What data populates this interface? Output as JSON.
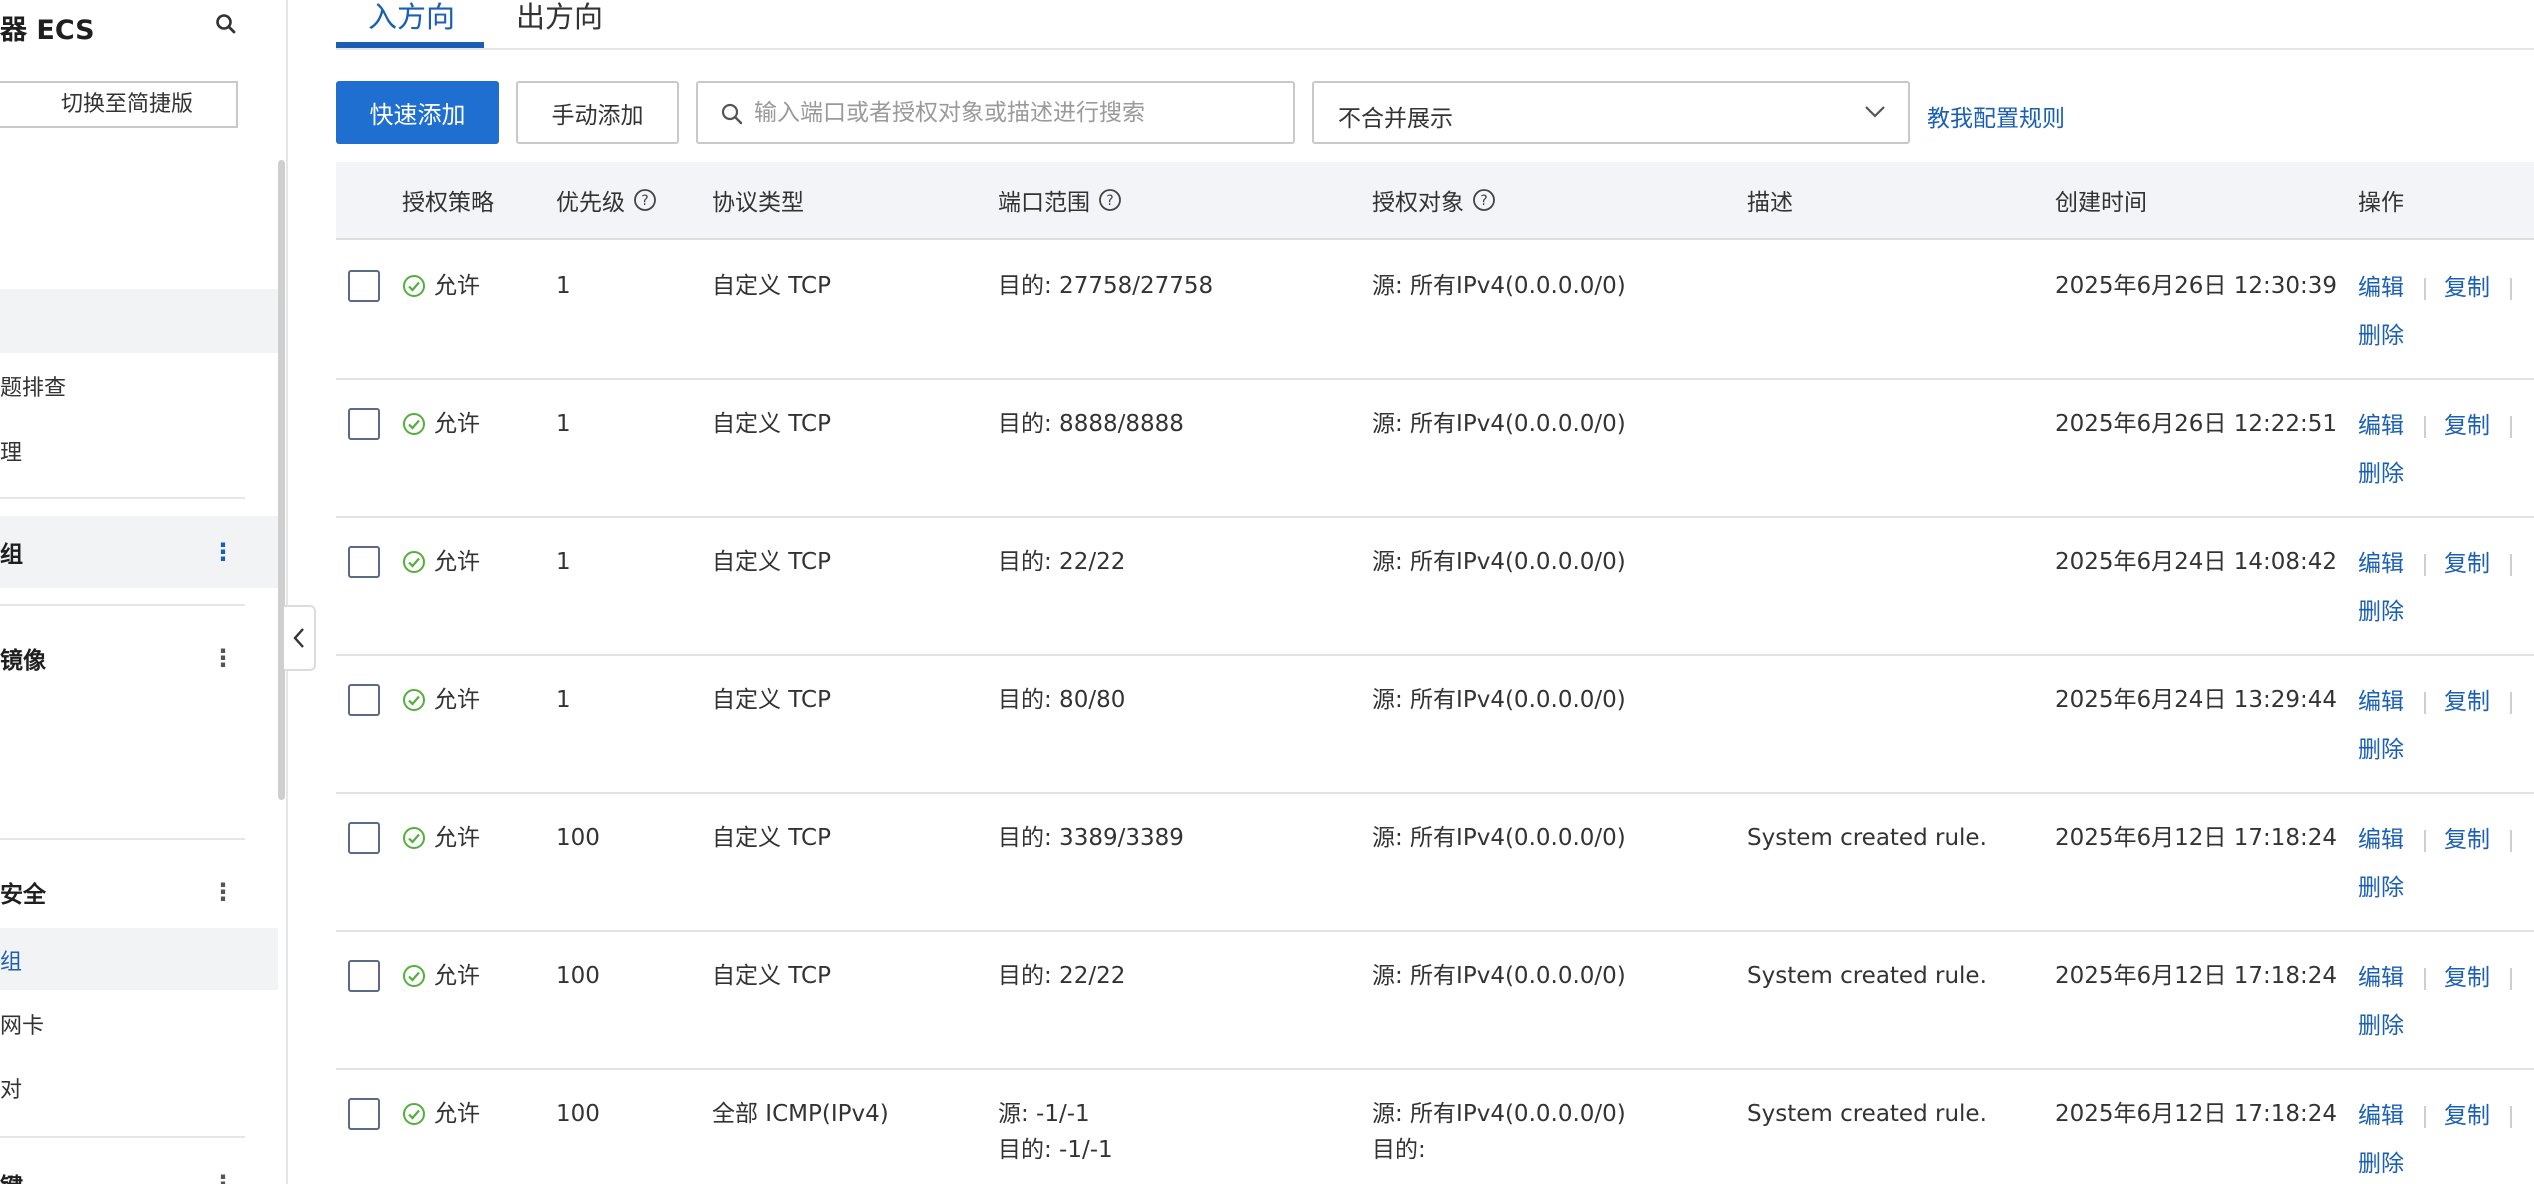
{
  "sidebar": {
    "title": "器 ECS",
    "switch_label": "切换至简捷版",
    "items": [
      {
        "label": "题排查"
      },
      {
        "label": "理"
      },
      {
        "label": "组"
      },
      {
        "label": "镜像"
      },
      {
        "label": "安全"
      },
      {
        "label": "组"
      },
      {
        "label": "网卡"
      },
      {
        "label": "对"
      },
      {
        "label": "键"
      }
    ]
  },
  "tabs": [
    {
      "label": "入方向",
      "active": true
    },
    {
      "label": "出方向",
      "active": false
    }
  ],
  "toolbar": {
    "quick_add": "快速添加",
    "manual_add": "手动添加",
    "search_placeholder": "输入端口或者授权对象或描述进行搜索",
    "merge_select": "不合并展示",
    "help_link": "教我配置规则"
  },
  "table": {
    "headers": {
      "policy": "授权策略",
      "priority": "优先级",
      "protocol": "协议类型",
      "port": "端口范围",
      "target": "授权对象",
      "desc": "描述",
      "created": "创建时间",
      "ops": "操作"
    },
    "actions": {
      "edit": "编辑",
      "copy": "复制",
      "delete": "删除"
    },
    "rows": [
      {
        "policy": "允许",
        "priority": "1",
        "protocol": "自定义 TCP",
        "port": "目的: 27758/27758",
        "port2": "",
        "target": "源: 所有IPv4(0.0.0.0/0)",
        "target2": "",
        "desc": "",
        "created": "2025年6月26日 12:30:39"
      },
      {
        "policy": "允许",
        "priority": "1",
        "protocol": "自定义 TCP",
        "port": "目的: 8888/8888",
        "port2": "",
        "target": "源: 所有IPv4(0.0.0.0/0)",
        "target2": "",
        "desc": "",
        "created": "2025年6月26日 12:22:51"
      },
      {
        "policy": "允许",
        "priority": "1",
        "protocol": "自定义 TCP",
        "port": "目的: 22/22",
        "port2": "",
        "target": "源: 所有IPv4(0.0.0.0/0)",
        "target2": "",
        "desc": "",
        "created": "2025年6月24日 14:08:42"
      },
      {
        "policy": "允许",
        "priority": "1",
        "protocol": "自定义 TCP",
        "port": "目的: 80/80",
        "port2": "",
        "target": "源: 所有IPv4(0.0.0.0/0)",
        "target2": "",
        "desc": "",
        "created": "2025年6月24日 13:29:44"
      },
      {
        "policy": "允许",
        "priority": "100",
        "protocol": "自定义 TCP",
        "port": "目的: 3389/3389",
        "port2": "",
        "target": "源: 所有IPv4(0.0.0.0/0)",
        "target2": "",
        "desc": "System created rule.",
        "created": "2025年6月12日 17:18:24"
      },
      {
        "policy": "允许",
        "priority": "100",
        "protocol": "自定义 TCP",
        "port": "目的: 22/22",
        "port2": "",
        "target": "源: 所有IPv4(0.0.0.0/0)",
        "target2": "",
        "desc": "System created rule.",
        "created": "2025年6月12日 17:18:24"
      },
      {
        "policy": "允许",
        "priority": "100",
        "protocol": "全部 ICMP(IPv4)",
        "port": "源: -1/-1",
        "port2": "目的: -1/-1",
        "target": "源: 所有IPv4(0.0.0.0/0)",
        "target2": "目的:",
        "desc": "System created rule.",
        "created": "2025年6月12日 17:18:24"
      }
    ]
  },
  "colors": {
    "accent": "#1f6fd1",
    "link": "#1a5fb4",
    "success": "#52b03a",
    "header_bg": "#f2f4f7"
  }
}
